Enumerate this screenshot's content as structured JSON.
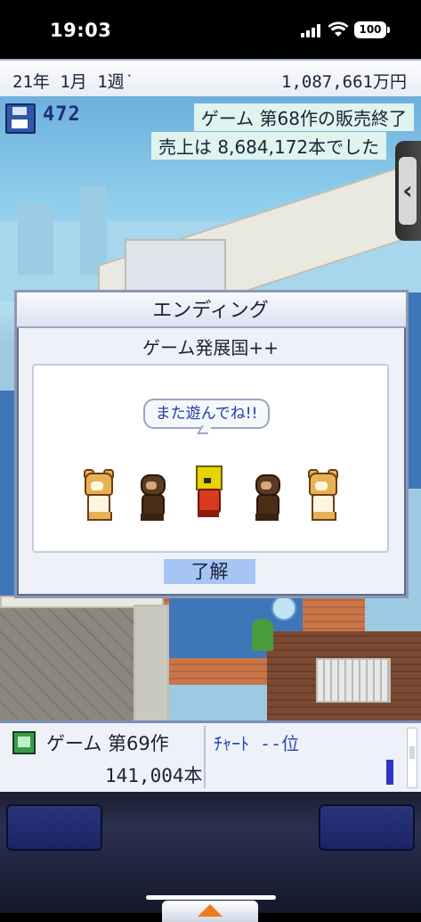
{
  "status_bar": {
    "time": "19:03",
    "battery": "100"
  },
  "info_bar": {
    "date": "21年 1月 1週˙",
    "money": "1,087,661万円"
  },
  "hud": {
    "save_count": "472",
    "message_line1": "ゲーム 第68作の販売終了",
    "message_line2": "売上は 8,684,172本でした"
  },
  "dialog": {
    "title": "エンディング",
    "subtitle": "ゲーム発展国++",
    "speech": "また遊んでね!!",
    "ok_label": "了解",
    "characters": [
      "bear",
      "monkey",
      "robot",
      "monkey",
      "bear"
    ]
  },
  "bottom_panel": {
    "game_label": "ゲーム 第69作",
    "sales": "141,004本",
    "chart_label": "ﾁｬｰﾄ --位"
  },
  "colors": {
    "accent_blue": "#2c35c8",
    "ok_button": "#a6c5f4",
    "menu_arrow": "#f07a1a"
  }
}
